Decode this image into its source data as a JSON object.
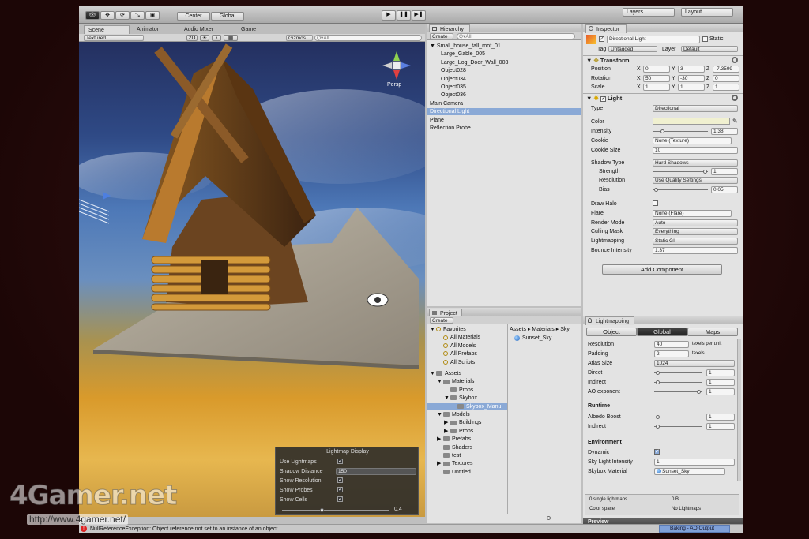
{
  "toolbar": {
    "center": "Center",
    "global": "Global",
    "layers": "Layers",
    "layout": "Layout"
  },
  "scene_tabs": [
    "Scene",
    "Animator",
    "Audio Mixer",
    "Game"
  ],
  "scene_bar": {
    "shading": "Textured",
    "mode2d": "2D",
    "gizmos": "Gizmos",
    "search_placeholder": "Q▾All"
  },
  "gizmo": {
    "persp": "Persp"
  },
  "lightmap_display": {
    "title": "Lightmap Display",
    "rows": [
      {
        "label": "Use Lightmaps",
        "check": true
      },
      {
        "label": "Shadow Distance",
        "value": "150"
      },
      {
        "label": "Show Resolution",
        "check": true
      },
      {
        "label": "Show Probes",
        "check": true
      },
      {
        "label": "Show Cells",
        "check": true
      }
    ],
    "slider": "0.4"
  },
  "hierarchy": {
    "title": "Hierarchy",
    "create": "Create",
    "search": "Q▾All",
    "items": [
      {
        "label": "Small_house_tall_roof_01",
        "level": 0,
        "arrow": "▼"
      },
      {
        "label": "Large_Gable_005",
        "level": 1
      },
      {
        "label": "Large_Log_Door_Wall_003",
        "level": 1
      },
      {
        "label": "Object028",
        "level": 1
      },
      {
        "label": "Object034",
        "level": 1
      },
      {
        "label": "Object035",
        "level": 1
      },
      {
        "label": "Object036",
        "level": 1
      },
      {
        "label": "Main Camera",
        "level": 0
      },
      {
        "label": "Directional Light",
        "level": 0,
        "selected": true
      },
      {
        "label": "Plane",
        "level": 0
      },
      {
        "label": "Reflection Probe",
        "level": 0
      }
    ]
  },
  "project": {
    "title": "Project",
    "create": "Create",
    "favorites_label": "Favorites",
    "favorites": [
      "All Materials",
      "All Models",
      "All Prefabs",
      "All Scripts"
    ],
    "assets_label": "Assets",
    "tree": [
      {
        "label": "Materials",
        "level": 1,
        "arrow": "▼"
      },
      {
        "label": "Props",
        "level": 2
      },
      {
        "label": "Skybox",
        "level": 2,
        "arrow": "▼"
      },
      {
        "label": "Skybox_Manu",
        "level": 3,
        "selected": true
      },
      {
        "label": "Models",
        "level": 1,
        "arrow": "▼"
      },
      {
        "label": "Buildings",
        "level": 2,
        "arrow": "▶"
      },
      {
        "label": "Props",
        "level": 2,
        "arrow": "▶"
      },
      {
        "label": "Prefabs",
        "level": 1,
        "arrow": "▶"
      },
      {
        "label": "Shaders",
        "level": 1
      },
      {
        "label": "test",
        "level": 1
      },
      {
        "label": "Textures",
        "level": 1,
        "arrow": "▶"
      },
      {
        "label": "Untitled",
        "level": 1
      }
    ],
    "breadcrumb": "Assets ▸ Materials ▸ Sky",
    "asset": "Sunset_Sky"
  },
  "inspector": {
    "title": "Inspector",
    "object_name": "Directional Light",
    "static": "Static",
    "tag_label": "Tag",
    "tag_value": "Untagged",
    "layer_label": "Layer",
    "layer_value": "Default",
    "transform": {
      "title": "Transform",
      "rows": [
        {
          "label": "Position",
          "x": "0",
          "y": "3",
          "z": "-7.3599"
        },
        {
          "label": "Rotation",
          "x": "50",
          "y": "-30",
          "z": "0"
        },
        {
          "label": "Scale",
          "x": "1",
          "y": "1",
          "z": "1"
        }
      ]
    },
    "light": {
      "title": "Light",
      "type_label": "Type",
      "type": "Directional",
      "color_label": "Color",
      "intensity_label": "Intensity",
      "intensity": "1.38",
      "cookie_label": "Cookie",
      "cookie": "None (Texture)",
      "cookie_size_label": "Cookie Size",
      "cookie_size": "10",
      "shadow_type_label": "Shadow Type",
      "shadow_type": "Hard Shadows",
      "strength_label": "Strength",
      "strength": "1",
      "resolution_label": "Resolution",
      "resolution": "Use Quality Settings",
      "bias_label": "Bias",
      "bias": "0.05",
      "draw_halo_label": "Draw Halo",
      "flare_label": "Flare",
      "flare": "None (Flare)",
      "render_mode_label": "Render Mode",
      "render_mode": "Auto",
      "culling_label": "Culling Mask",
      "culling": "Everything",
      "lightmapping_label": "Lightmapping",
      "lightmapping": "Static GI",
      "bounce_label": "Bounce Intensity",
      "bounce": "1.37"
    },
    "add_component": "Add Component"
  },
  "lightmapping": {
    "title": "Lightmapping",
    "tabs": [
      "Object",
      "Global",
      "Maps"
    ],
    "resolution_label": "Resolution",
    "resolution": "40",
    "resolution_unit": "texels per unit",
    "padding_label": "Padding",
    "padding": "2",
    "padding_unit": "texels",
    "atlas_label": "Atlas Size",
    "atlas": "1024",
    "direct_label": "Direct",
    "direct": "1",
    "indirect_label": "Indirect",
    "indirect": "1",
    "ao_label": "AO exponent",
    "ao": "1",
    "runtime_label": "Runtime",
    "albedo_label": "Albedo Boost",
    "albedo": "1",
    "indirect2_label": "Indirect",
    "indirect2": "1",
    "env_label": "Environment",
    "dynamic_label": "Dynamic",
    "sky_label": "Sky Light Intensity",
    "sky": "1",
    "skybox_label": "Skybox Material",
    "skybox": "Sunset_Sky",
    "lightmaps_count": "0 single lightmaps",
    "size": "0 B",
    "colorspace_label": "Color space",
    "nolightmaps": "No Lightmaps",
    "preview": "Preview",
    "baking": "Baking - AO Output"
  },
  "status": {
    "error": "NullReferenceException: Object reference not set to an instance of an object"
  },
  "watermark": {
    "logo": "4Gamer.net",
    "url": "http://www.4gamer.net/"
  },
  "colors": {
    "selection": "#8aa9d6",
    "light_color": "#f0f0d0"
  }
}
